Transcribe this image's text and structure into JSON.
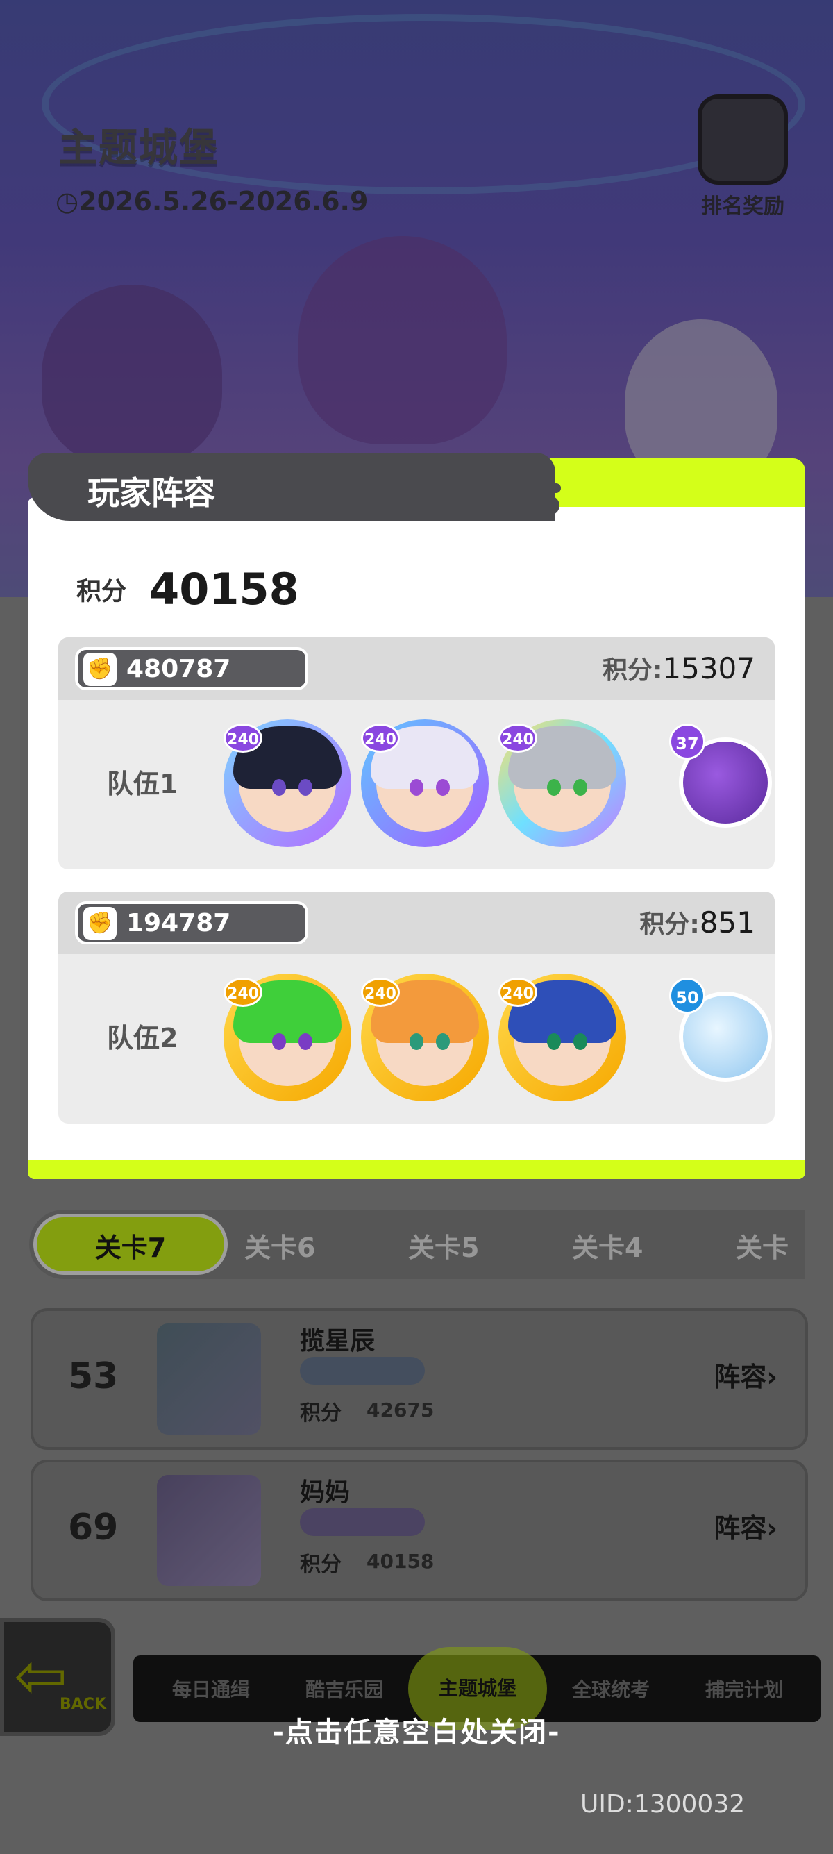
{
  "castle": {
    "title": "主题城堡",
    "date_range": "2026.5.26-2026.6.9",
    "rank_reward_label": "排名奖励"
  },
  "ranking_rows": [
    {
      "rank": "53",
      "name": "揽星辰",
      "score_label": "积分",
      "score": "42675",
      "lineup_label": "阵容"
    },
    {
      "rank": "69",
      "name": "妈妈",
      "score_label": "积分",
      "score": "40158",
      "lineup_label": "阵容"
    }
  ],
  "stage_tabs": [
    "关卡7",
    "关卡6",
    "关卡5",
    "关卡4",
    "关卡"
  ],
  "bottom_nav": {
    "back_label": "BACK",
    "items": [
      "每日通缉",
      "酷吉乐园",
      "主题城堡",
      "全球统考",
      "捕完计划"
    ]
  },
  "modal": {
    "title": "玩家阵容",
    "total_label": "积分",
    "total_score": "40158",
    "teams": [
      {
        "name": "队伍1",
        "power": "480787",
        "score_label": "积分:",
        "score": "15307",
        "hero_levels": [
          "240",
          "240",
          "240"
        ],
        "pet_level": "37"
      },
      {
        "name": "队伍2",
        "power": "194787",
        "score_label": "积分:",
        "score": "851",
        "hero_levels": [
          "240",
          "240",
          "240"
        ],
        "pet_level": "50"
      }
    ]
  },
  "close_hint": "-点击任意空白处关闭-",
  "uid": "UID:1300032",
  "colors": {
    "accent_lime": "#d4ff19",
    "header_dark": "#4a4a4e",
    "level_purple": "#8a47e0"
  }
}
